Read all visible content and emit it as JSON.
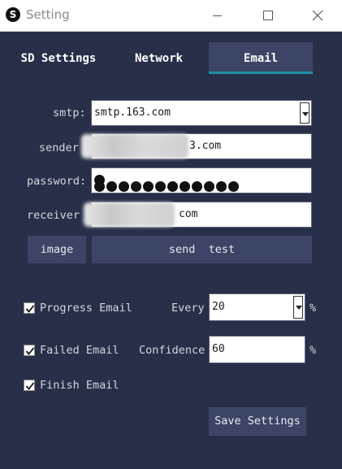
{
  "window": {
    "title": "Setting",
    "app_icon": "S"
  },
  "tabs": [
    {
      "label": "SD Settings",
      "active": false
    },
    {
      "label": "Network",
      "active": false
    },
    {
      "label": "Email",
      "active": true
    }
  ],
  "email": {
    "smtp_label": "smtp:",
    "smtp_value": "smtp.163.com",
    "sender_label": "sender",
    "sender_value_visible": "3.com",
    "password_label": "password:",
    "password_dots": 12,
    "receiver_label": "receiver",
    "receiver_value_visible": "com",
    "image_button": "image",
    "send_test_button": "send  test"
  },
  "options": {
    "progress_label": "Progress Email",
    "progress_checked": true,
    "every_label": "Every",
    "every_value": "20",
    "every_unit": "%",
    "failed_label": "Failed Email",
    "failed_checked": true,
    "confidence_label": "Confidence",
    "confidence_value": "60",
    "confidence_unit": "%",
    "finish_label": "Finish Email",
    "finish_checked": true
  },
  "save_button": "Save Settings",
  "colors": {
    "background": "#283049",
    "tab_active": "#3c4566",
    "accent": "#1b8fa0"
  }
}
